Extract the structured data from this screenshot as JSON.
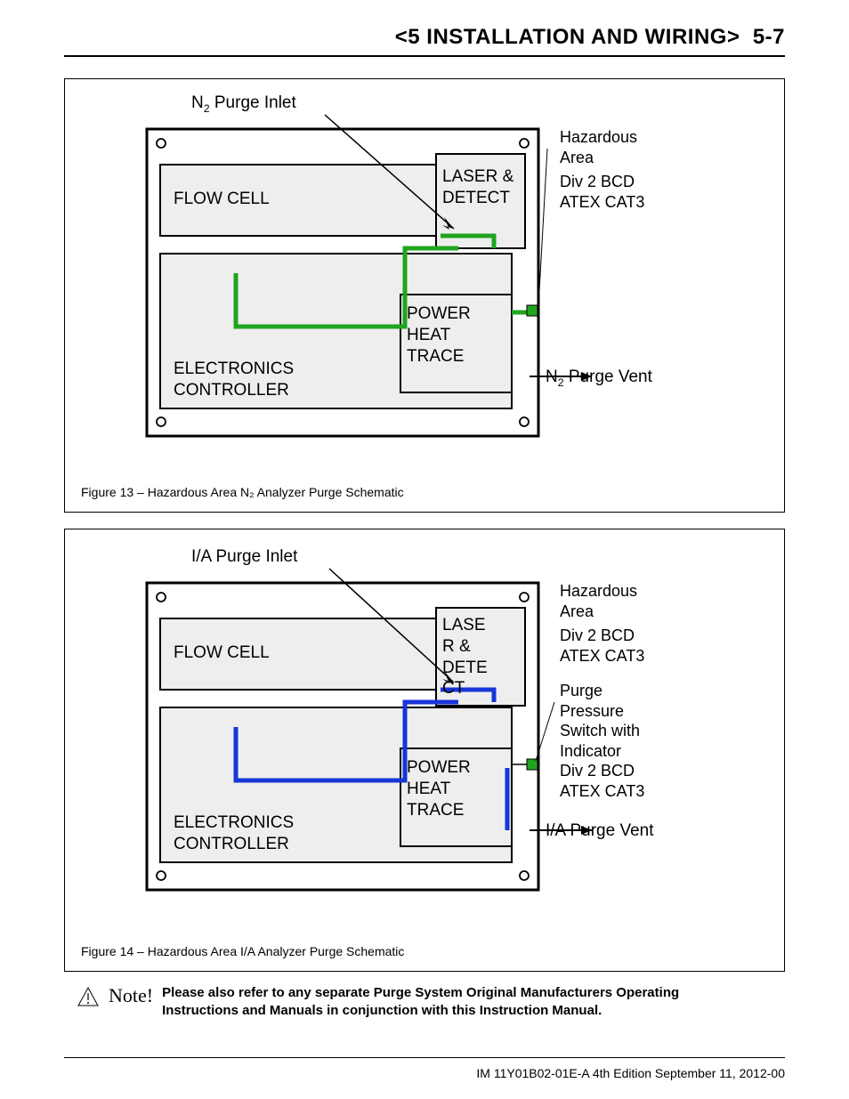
{
  "header": "<5 INSTALLATION AND WIRING>  5-7",
  "fig13": {
    "caption": "Figure 13 – Hazardous Area N₂ Analyzer Purge Schematic",
    "purge_inlet_prefix": "N",
    "purge_inlet_sub": "2",
    "purge_inlet_suffix": " Purge Inlet",
    "purge_vent_prefix": "N",
    "purge_vent_sub": "2",
    "purge_vent_suffix": " Purge Vent",
    "haz1": "Hazardous\nArea",
    "haz2": "Div 2 BCD\nATEX CAT3",
    "flow_cell": "FLOW CELL",
    "laser_detect": "LASER &\nDETECT",
    "power_heat_trace": "POWER\nHEAT\nTRACE",
    "electronics": "ELECTRONICS\nCONTROLLER"
  },
  "fig14": {
    "caption": "Figure 14 – Hazardous Area I/A Analyzer Purge Schematic",
    "purge_inlet": "I/A Purge Inlet",
    "purge_vent": "I/A Purge Vent",
    "haz1": "Hazardous\nArea",
    "haz2": "Div 2 BCD\nATEX CAT3",
    "switch_text": "Purge\nPressure\nSwitch with\nIndicator\nDiv 2 BCD\nATEX CAT3",
    "flow_cell": "FLOW CELL",
    "laser_detect": "LASE\nR &\nDETE\nCT",
    "power_heat_trace": "POWER\nHEAT\nTRACE",
    "electronics": "ELECTRONICS\nCONTROLLER"
  },
  "note": {
    "label": "Note!",
    "text": "Please also refer to any separate Purge System Original Manufacturers Operating Instructions and Manuals in conjunction with this Instruction Manual."
  },
  "footer": "IM 11Y01B02-01E-A  4th Edition September 11, 2012-00"
}
